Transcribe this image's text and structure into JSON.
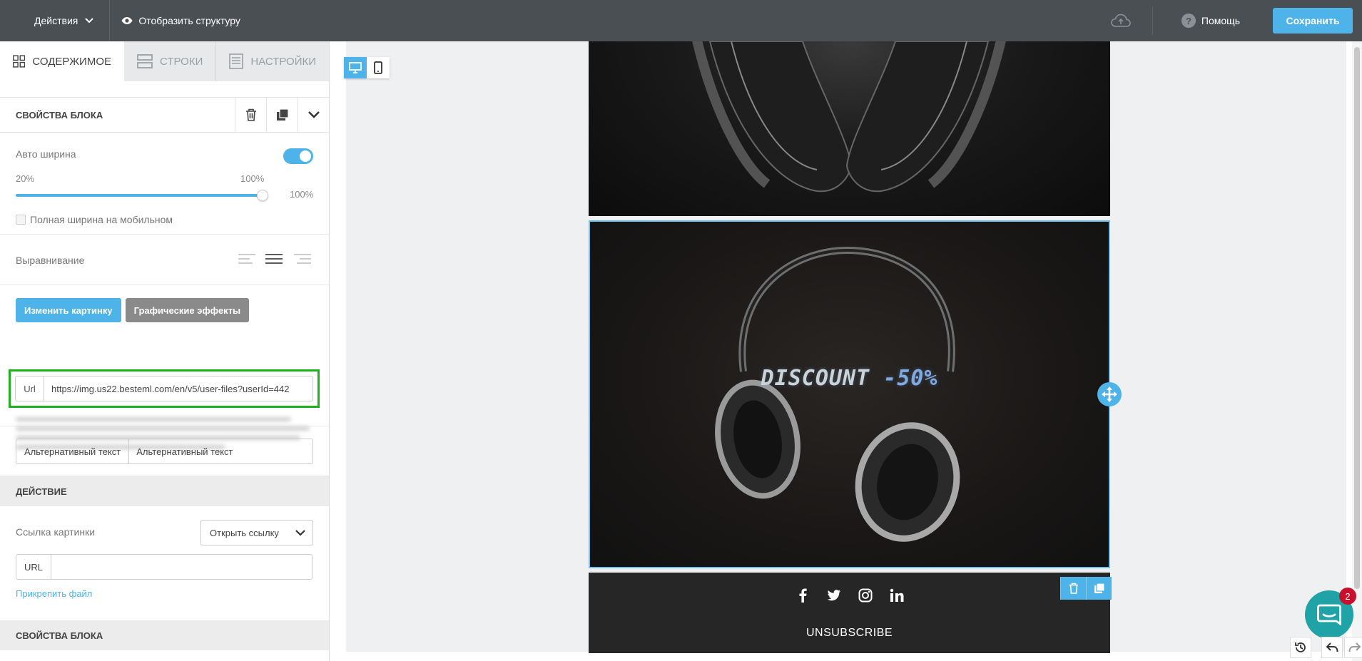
{
  "topbar": {
    "actions_label": "Действия",
    "structure_label": "Отобразить структуру",
    "help_label": "Помощь",
    "save_label": "Сохранить"
  },
  "sidebar": {
    "tabs": [
      {
        "label": "СОДЕРЖИМОЕ"
      },
      {
        "label": "СТРОКИ"
      },
      {
        "label": "НАСТРОЙКИ"
      }
    ],
    "block_props_title": "СВОЙСТВА БЛОКА",
    "auto_width_label": "Авто ширина",
    "slider_min": "20%",
    "slider_max": "100%",
    "slider_value": "100%",
    "full_width_mobile_label": "Полная ширина на мобильном",
    "alignment_label": "Выравнивание",
    "change_image_button": "Изменить картинку",
    "graphic_effects_button": "Графические эффекты",
    "url_prefix": "Url",
    "url_value": "https://img.us22.besteml.com/en/v5/user-files?userId=442",
    "alt_text_prefix": "Альтернативный текст",
    "alt_text_value": "Альтернативный текст",
    "action_title": "ДЕЙСТВИЕ",
    "image_link_label": "Ссылка картинки",
    "image_link_select": "Открыть ссылку",
    "link_url_prefix": "URL",
    "link_url_value": "",
    "attach_file_link": "Прикрепить файл",
    "block_props_title_2": "СВОЙСТВА БЛОКА"
  },
  "canvas": {
    "discount_text_1": "DISCOUNT",
    "discount_text_2": "-50%",
    "unsubscribe_label": "UNSUBSCRIBE"
  },
  "chat": {
    "badge_count": "2"
  },
  "colors": {
    "accent": "#4db3e8",
    "topbar": "#4a4f54",
    "highlight": "#1db11d",
    "footer": "#262626",
    "chat": "#1fa3a7"
  }
}
